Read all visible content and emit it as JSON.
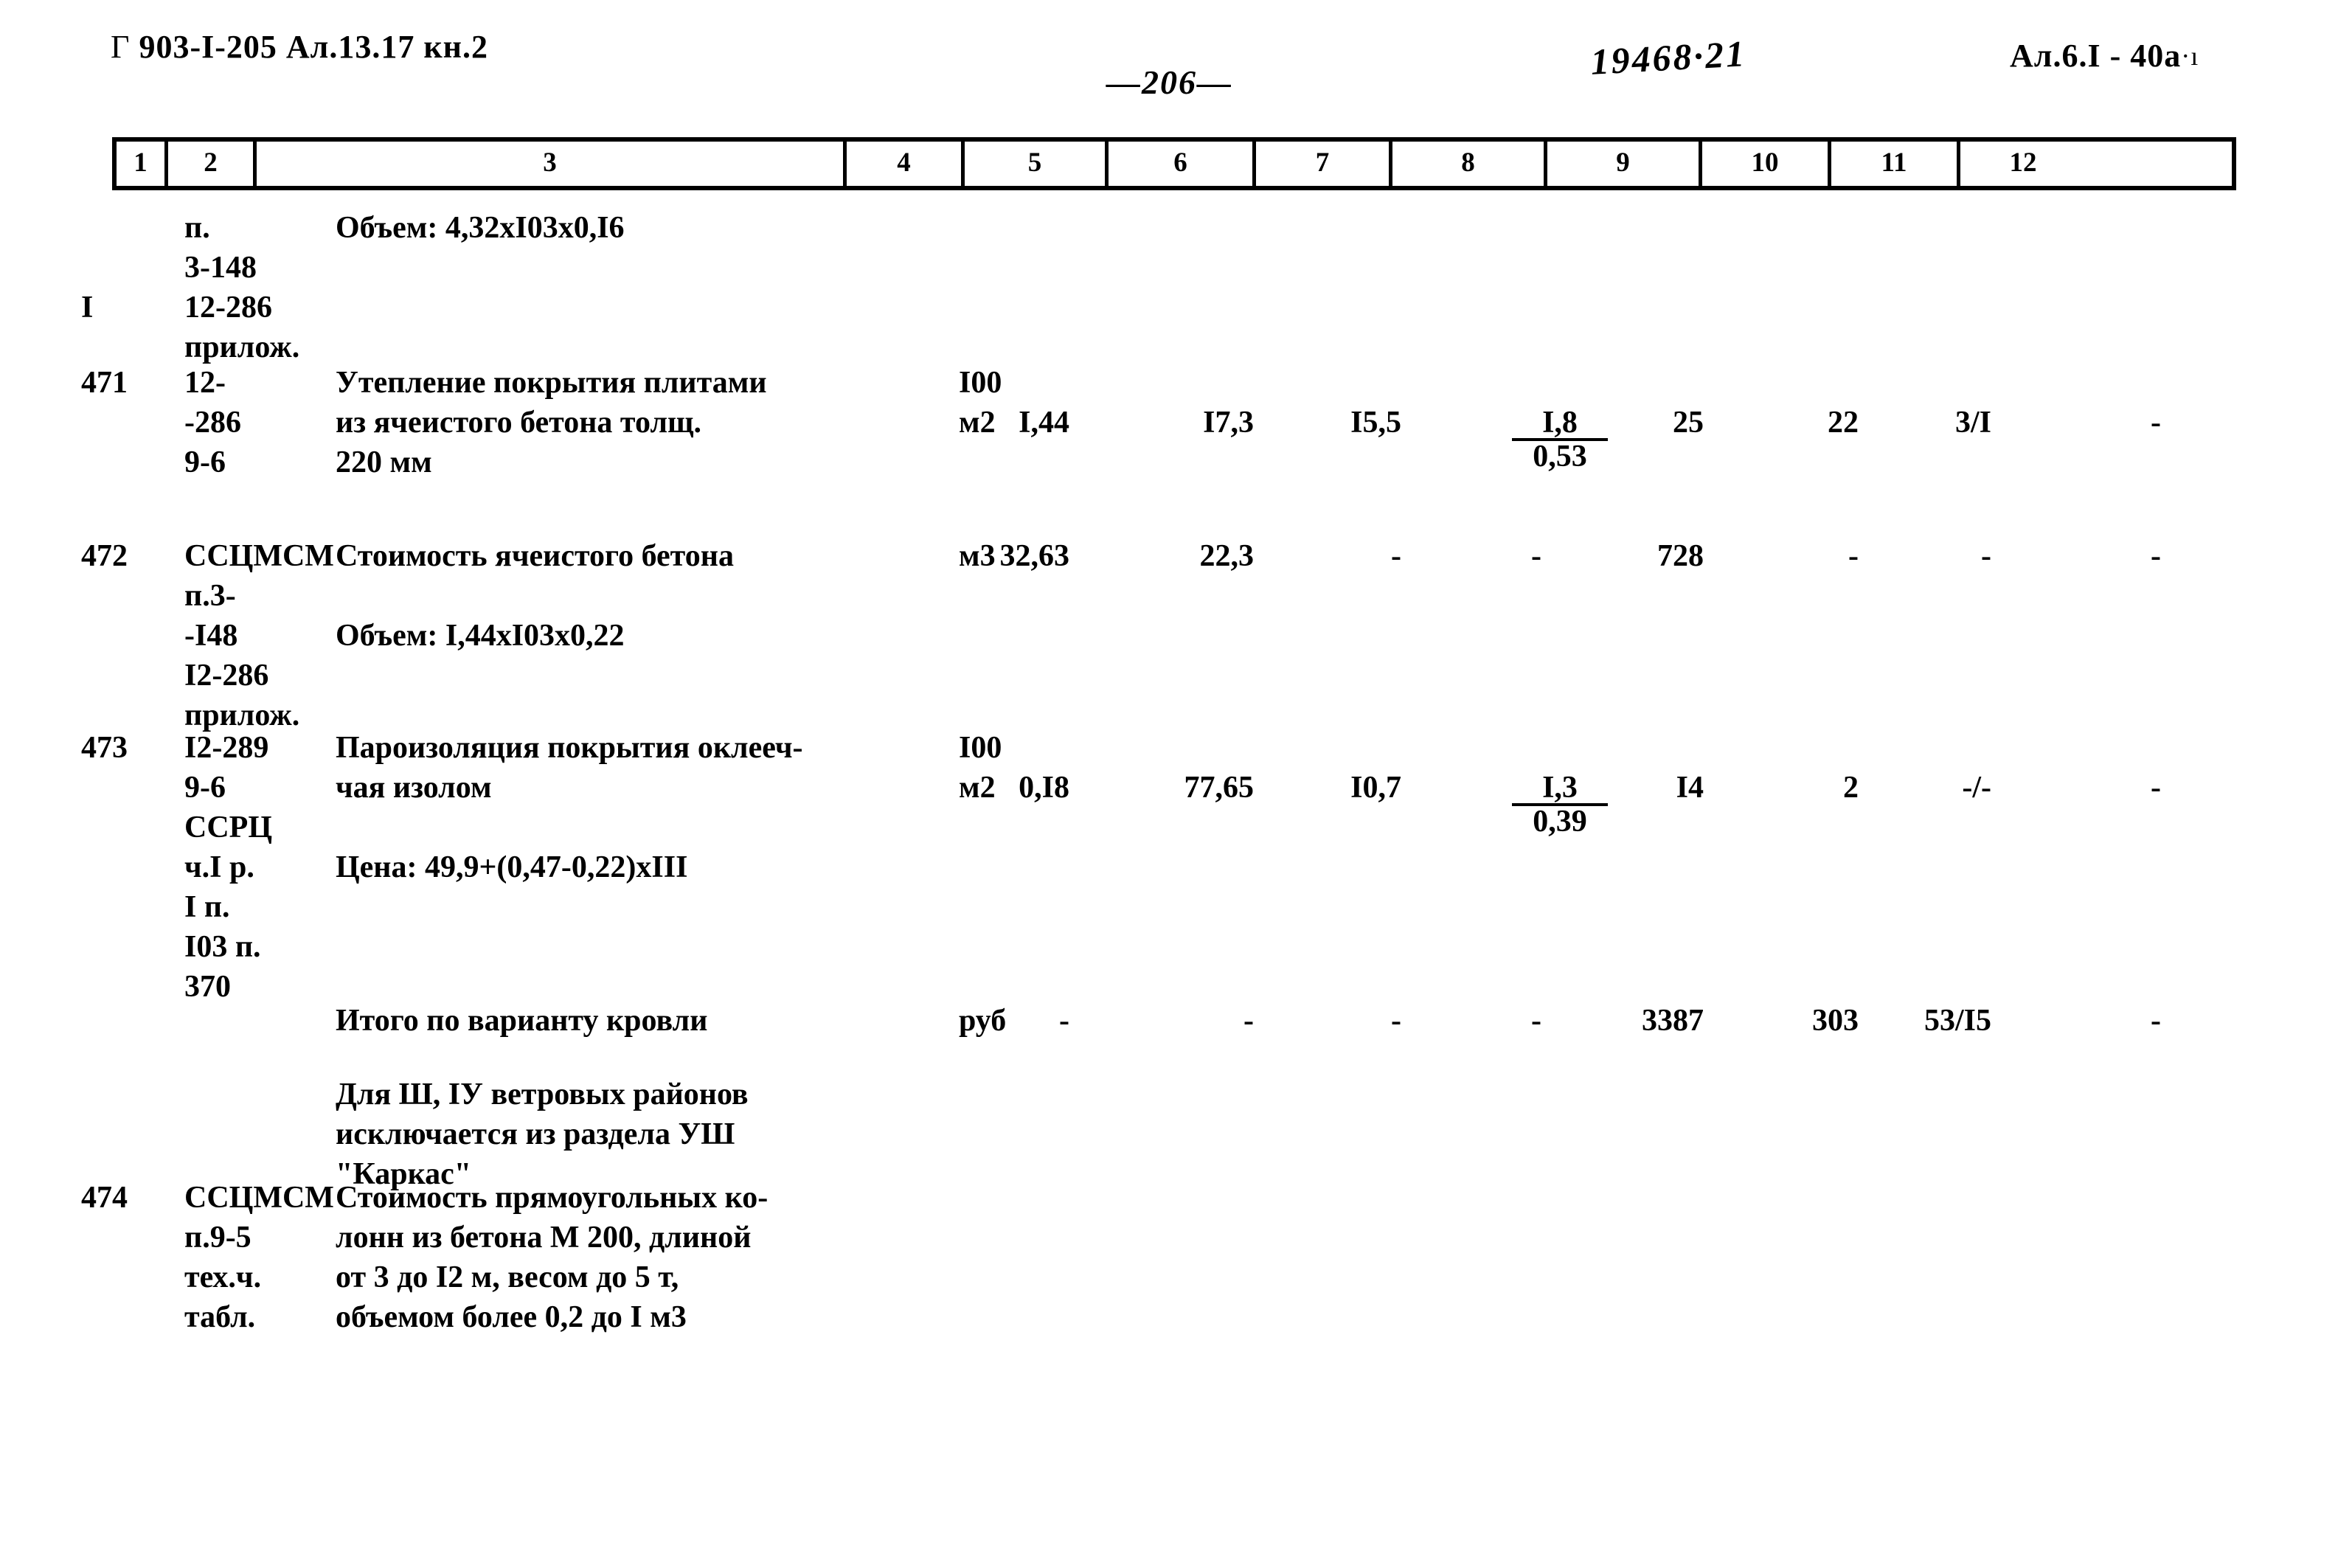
{
  "header": {
    "left_bracket": "Г",
    "left": "903-I-205 Ал.13.17 кн.2",
    "page_number": "—206—",
    "stamp": "19468·21",
    "right": "Ал.6.I - 40а",
    "right_tick": "·ı"
  },
  "table": {
    "column_numbers": [
      "1",
      "2",
      "3",
      "4",
      "5",
      "6",
      "7",
      "8",
      "9",
      "10",
      "11",
      "12"
    ],
    "rows": [
      {
        "num": "I",
        "code": "п.\n3-148\n12-286\nприлож.",
        "desc": "Объем: 4,32хI03х0,I6",
        "unit": "",
        "c5": "",
        "c6": "",
        "c7": "",
        "c8_num": "",
        "c8_den": "",
        "c9": "",
        "c10": "",
        "c11": "",
        "c12": ""
      },
      {
        "num": "471",
        "code": "12-\n-286\n9-6",
        "desc": "Утепление покрытия плитами\nиз ячеистого бетона толщ.\n220 мм",
        "unit": "I00\nм2",
        "c5": "I,44",
        "c6": "I7,3",
        "c7": "I5,5",
        "c8_num": "I,8",
        "c8_den": "0,53",
        "c9": "25",
        "c10": "22",
        "c11": "3/I",
        "c12": "-"
      },
      {
        "num": "472",
        "code": "ССЦМСМ\nп.3-\n-I48\nI2-286\nприлож.",
        "desc": "Стоимость ячеистого бетона",
        "desc2": "Объем: I,44хI03х0,22",
        "unit": "м3",
        "c5": "32,63",
        "c6": "22,3",
        "c7": "-",
        "c8_num": "-",
        "c8_den": "",
        "c9": "728",
        "c10": "-",
        "c11": "-",
        "c12": "-"
      },
      {
        "num": "473",
        "code": "I2-289\n9-6\nССРЦ\nч.I р.\nI п.\nI03 п.\n370",
        "desc": "Пароизоляция покрытия оклееч-\nчая изолом",
        "desc2": "Цена: 49,9+(0,47-0,22)хIII",
        "unit": "I00\nм2",
        "c5": "0,I8",
        "c6": "77,65",
        "c7": "I0,7",
        "c8_num": "I,3",
        "c8_den": "0,39",
        "c9": "I4",
        "c10": "2",
        "c11": "-/-",
        "c12": "-"
      },
      {
        "num": "",
        "code": "",
        "desc": "Итого по варианту кровли",
        "unit": "руб",
        "c5": "-",
        "c6": "-",
        "c7": "-",
        "c8_num": "-",
        "c8_den": "",
        "c9": "3387",
        "c10": "303",
        "c11": "53/I5",
        "c12": "-"
      },
      {
        "num": "",
        "code": "",
        "desc": "Для Ш, IУ ветровых районов\nисключается из раздела УШ\n\"Каркас\"",
        "unit": "",
        "c5": "",
        "c6": "",
        "c7": "",
        "c8_num": "",
        "c8_den": "",
        "c9": "",
        "c10": "",
        "c11": "",
        "c12": ""
      },
      {
        "num": "474",
        "code": "ССЦМСМ\nп.9-5\nтех.ч.\nтабл.",
        "desc": "Стоимость прямоугольных ко-\nлонн из бетона М 200, длиной\nот 3 до I2 м, весом до 5 т,\nобъемом более 0,2 до I м3",
        "unit": "",
        "c5": "",
        "c6": "",
        "c7": "",
        "c8_num": "",
        "c8_den": "",
        "c9": "",
        "c10": "",
        "c11": "",
        "c12": ""
      }
    ]
  }
}
